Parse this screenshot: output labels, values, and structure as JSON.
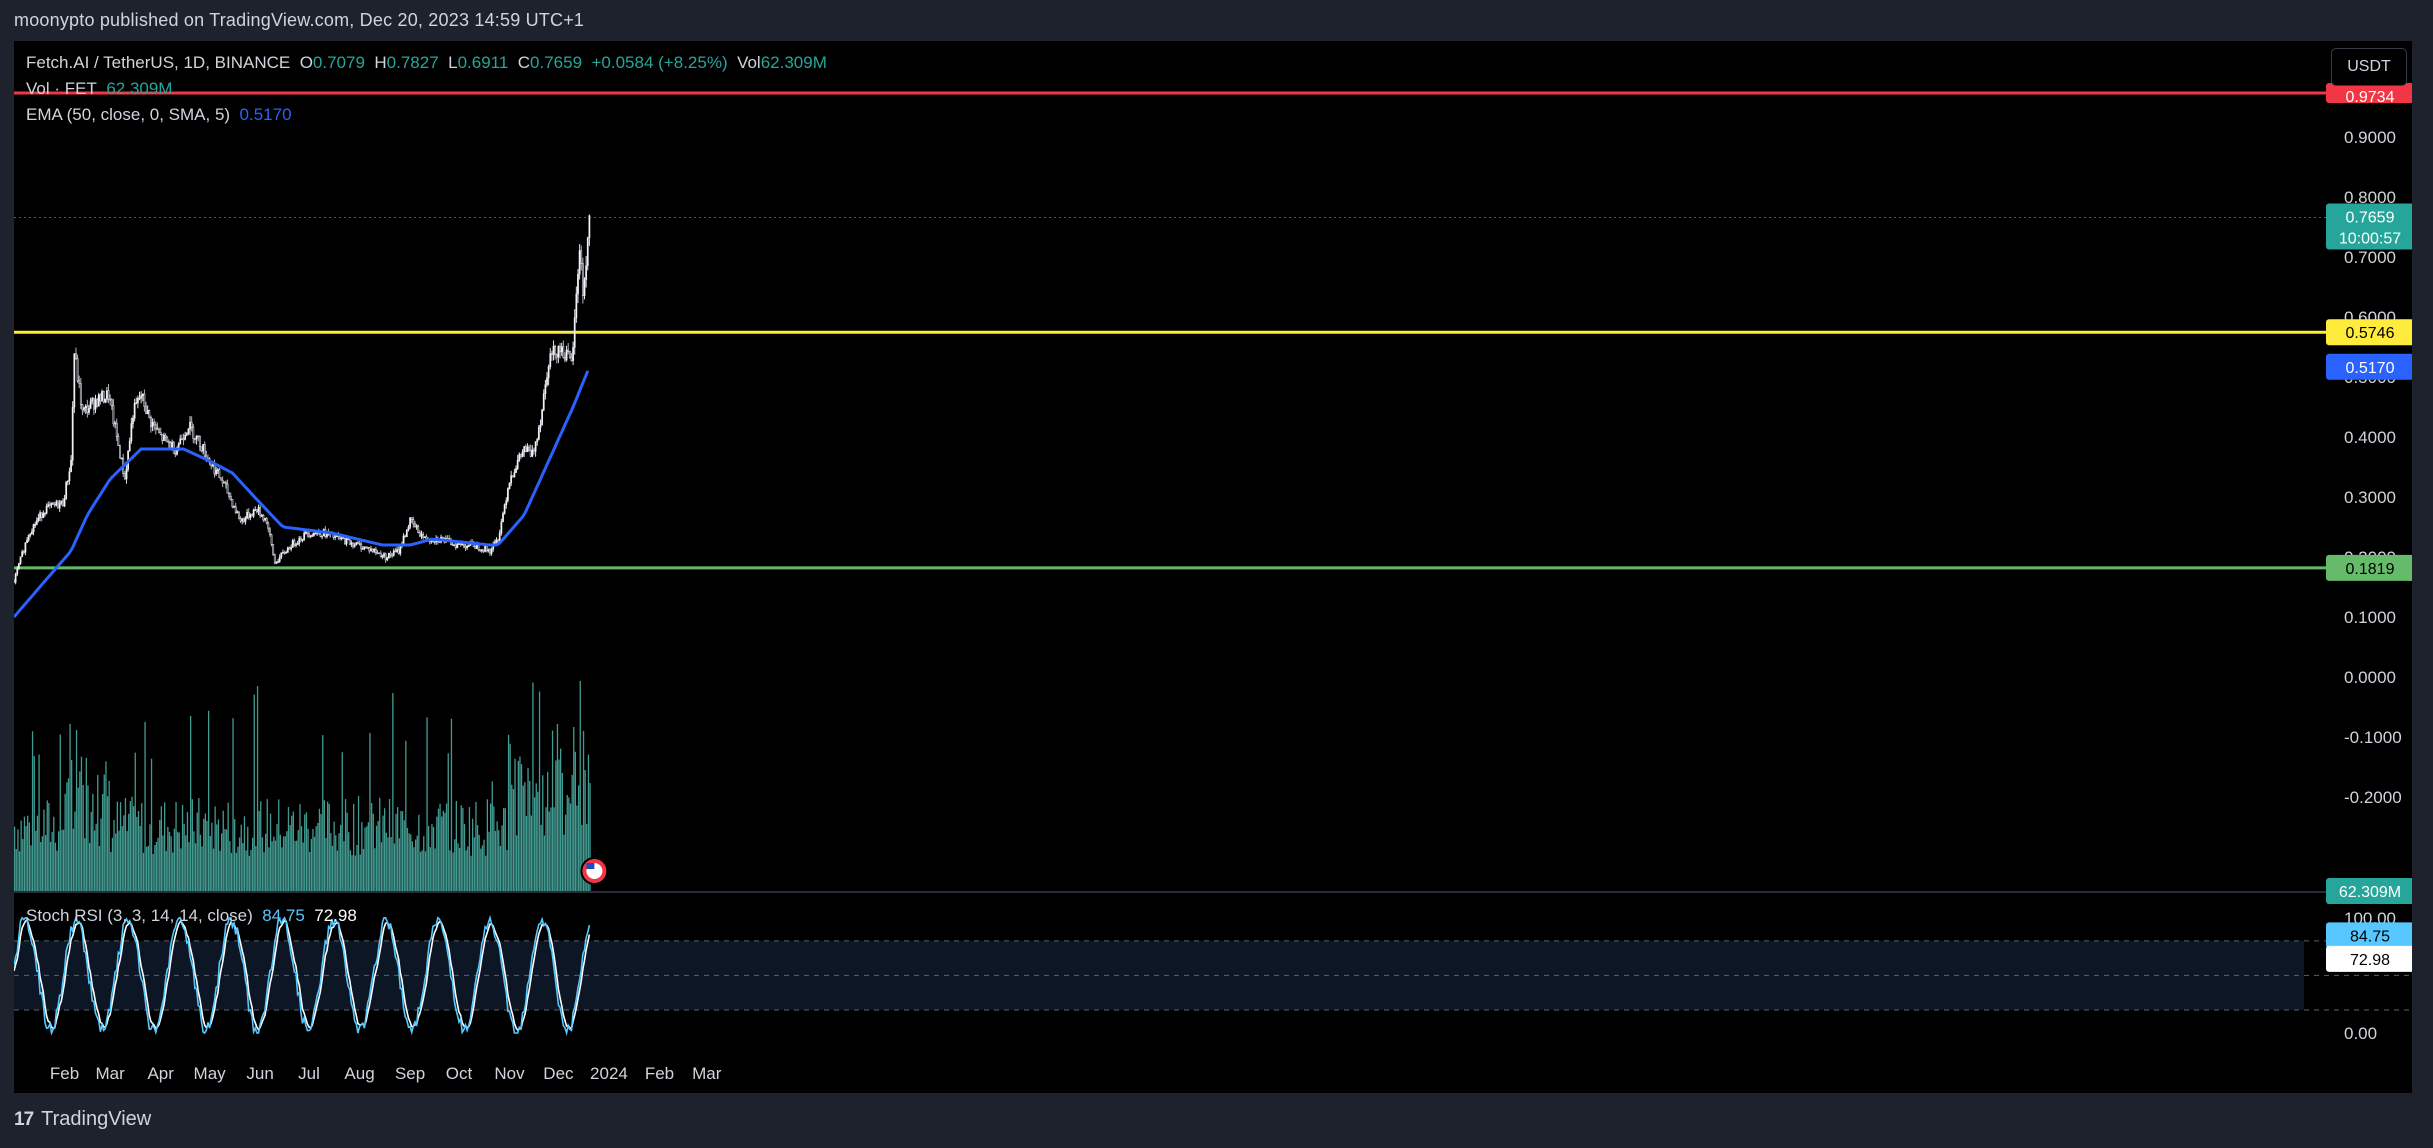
{
  "header": {
    "published": "moonypto published on TradingView.com, Dec 20, 2023 14:59 UTC+1"
  },
  "footer": {
    "brand": "TradingView"
  },
  "currency_button": "USDT",
  "legend": {
    "symbol": "Fetch.AI / TetherUS, 1D, BINANCE",
    "o_label": "O",
    "o": "0.7079",
    "h_label": "H",
    "h": "0.7827",
    "l_label": "L",
    "l": "0.6911",
    "c_label": "C",
    "c": "0.7659",
    "change": "+0.0584 (+8.25%)",
    "vol_label": "Vol",
    "vol": "62.309M",
    "vol_ind_label": "Vol · FET",
    "vol_ind_value": "62.309M",
    "ema_label": "EMA (50, close, 0, SMA, 5)",
    "ema_value": "0.5170",
    "stoch_label": "Stoch RSI (3, 3, 14, 14, close)",
    "stoch_k": "84.75",
    "stoch_d": "72.98"
  },
  "badges": {
    "red_line": "0.9734",
    "price": "0.7659",
    "countdown": "10:00:57",
    "yellow_line": "0.5746",
    "ema": "0.5170",
    "green_line": "0.1819",
    "volume": "62.309M",
    "stoch_k": "84.75",
    "stoch_d": "72.98"
  },
  "colors": {
    "up": "#26a69a",
    "down": "#ef5350",
    "ema": "#2962ff",
    "red_line": "#f23645",
    "yellow_line": "#ffeb3b",
    "green_line": "#66bb6a",
    "volume": "#4db6ac",
    "stoch_k": "#56c8ff",
    "stoch_d": "#ffffff"
  },
  "chart_data": {
    "type": "line",
    "symbol": "Fetch.AI / TetherUS",
    "interval": "1D",
    "exchange": "BINANCE",
    "y_axis_ticks": [
      "0.9000",
      "0.8000",
      "0.7000",
      "0.6000",
      "0.5000",
      "0.4000",
      "0.3000",
      "0.2000",
      "0.1000",
      "0.0000",
      "-0.1000",
      "-0.2000"
    ],
    "x_axis_ticks": [
      "Feb",
      "Mar",
      "Apr",
      "May",
      "Jun",
      "Jul",
      "Aug",
      "Sep",
      "Oct",
      "Nov",
      "Dec",
      "2024",
      "Feb",
      "Mar"
    ],
    "horizontal_lines": [
      {
        "value": 0.9734,
        "color": "red"
      },
      {
        "value": 0.5746,
        "color": "yellow"
      },
      {
        "value": 0.1819,
        "color": "green"
      }
    ],
    "price_series": {
      "name": "FET/USDT close (approx.)",
      "x": [
        "2023-01-01",
        "2023-01-10",
        "2023-01-20",
        "2023-01-31",
        "2023-02-05",
        "2023-02-07",
        "2023-02-12",
        "2023-02-20",
        "2023-02-28",
        "2023-03-05",
        "2023-03-10",
        "2023-03-15",
        "2023-03-20",
        "2023-03-25",
        "2023-04-01",
        "2023-04-10",
        "2023-04-18",
        "2023-04-25",
        "2023-05-01",
        "2023-05-10",
        "2023-05-20",
        "2023-05-30",
        "2023-06-05",
        "2023-06-10",
        "2023-06-20",
        "2023-06-30",
        "2023-07-10",
        "2023-07-20",
        "2023-07-31",
        "2023-08-10",
        "2023-08-17",
        "2023-08-25",
        "2023-09-01",
        "2023-09-10",
        "2023-09-20",
        "2023-09-30",
        "2023-10-10",
        "2023-10-20",
        "2023-10-25",
        "2023-11-01",
        "2023-11-10",
        "2023-11-15",
        "2023-11-20",
        "2023-11-25",
        "2023-12-01",
        "2023-12-05",
        "2023-12-09",
        "2023-12-11",
        "2023-12-14",
        "2023-12-16",
        "2023-12-18",
        "2023-12-20"
      ],
      "values": [
        0.16,
        0.24,
        0.28,
        0.29,
        0.36,
        0.54,
        0.44,
        0.46,
        0.47,
        0.4,
        0.33,
        0.44,
        0.47,
        0.43,
        0.4,
        0.38,
        0.42,
        0.39,
        0.36,
        0.32,
        0.26,
        0.28,
        0.26,
        0.19,
        0.22,
        0.24,
        0.24,
        0.23,
        0.22,
        0.21,
        0.2,
        0.21,
        0.26,
        0.23,
        0.23,
        0.22,
        0.22,
        0.21,
        0.23,
        0.33,
        0.38,
        0.37,
        0.43,
        0.53,
        0.55,
        0.54,
        0.52,
        0.59,
        0.72,
        0.64,
        0.69,
        0.7659
      ]
    },
    "ema_series": {
      "name": "EMA (50, close, 0, SMA, 5)",
      "x": [
        "2023-01-01",
        "2023-01-20",
        "2023-02-05",
        "2023-02-15",
        "2023-03-01",
        "2023-03-20",
        "2023-04-15",
        "2023-05-01",
        "2023-05-15",
        "2023-06-01",
        "2023-06-15",
        "2023-07-15",
        "2023-08-15",
        "2023-09-01",
        "2023-09-15",
        "2023-10-20",
        "2023-10-25",
        "2023-11-10",
        "2023-11-25",
        "2023-12-10",
        "2023-12-20"
      ],
      "values": [
        0.1,
        0.16,
        0.21,
        0.27,
        0.33,
        0.38,
        0.38,
        0.36,
        0.34,
        0.29,
        0.25,
        0.24,
        0.22,
        0.22,
        0.23,
        0.22,
        0.22,
        0.27,
        0.36,
        0.45,
        0.517
      ]
    },
    "volume_series": {
      "last_value": "62.309M"
    },
    "stoch_rsi": {
      "k": 84.75,
      "d": 72.98,
      "bands": [
        20,
        50,
        80
      ],
      "axis_ticks": [
        "100.00",
        "0.00"
      ]
    }
  }
}
